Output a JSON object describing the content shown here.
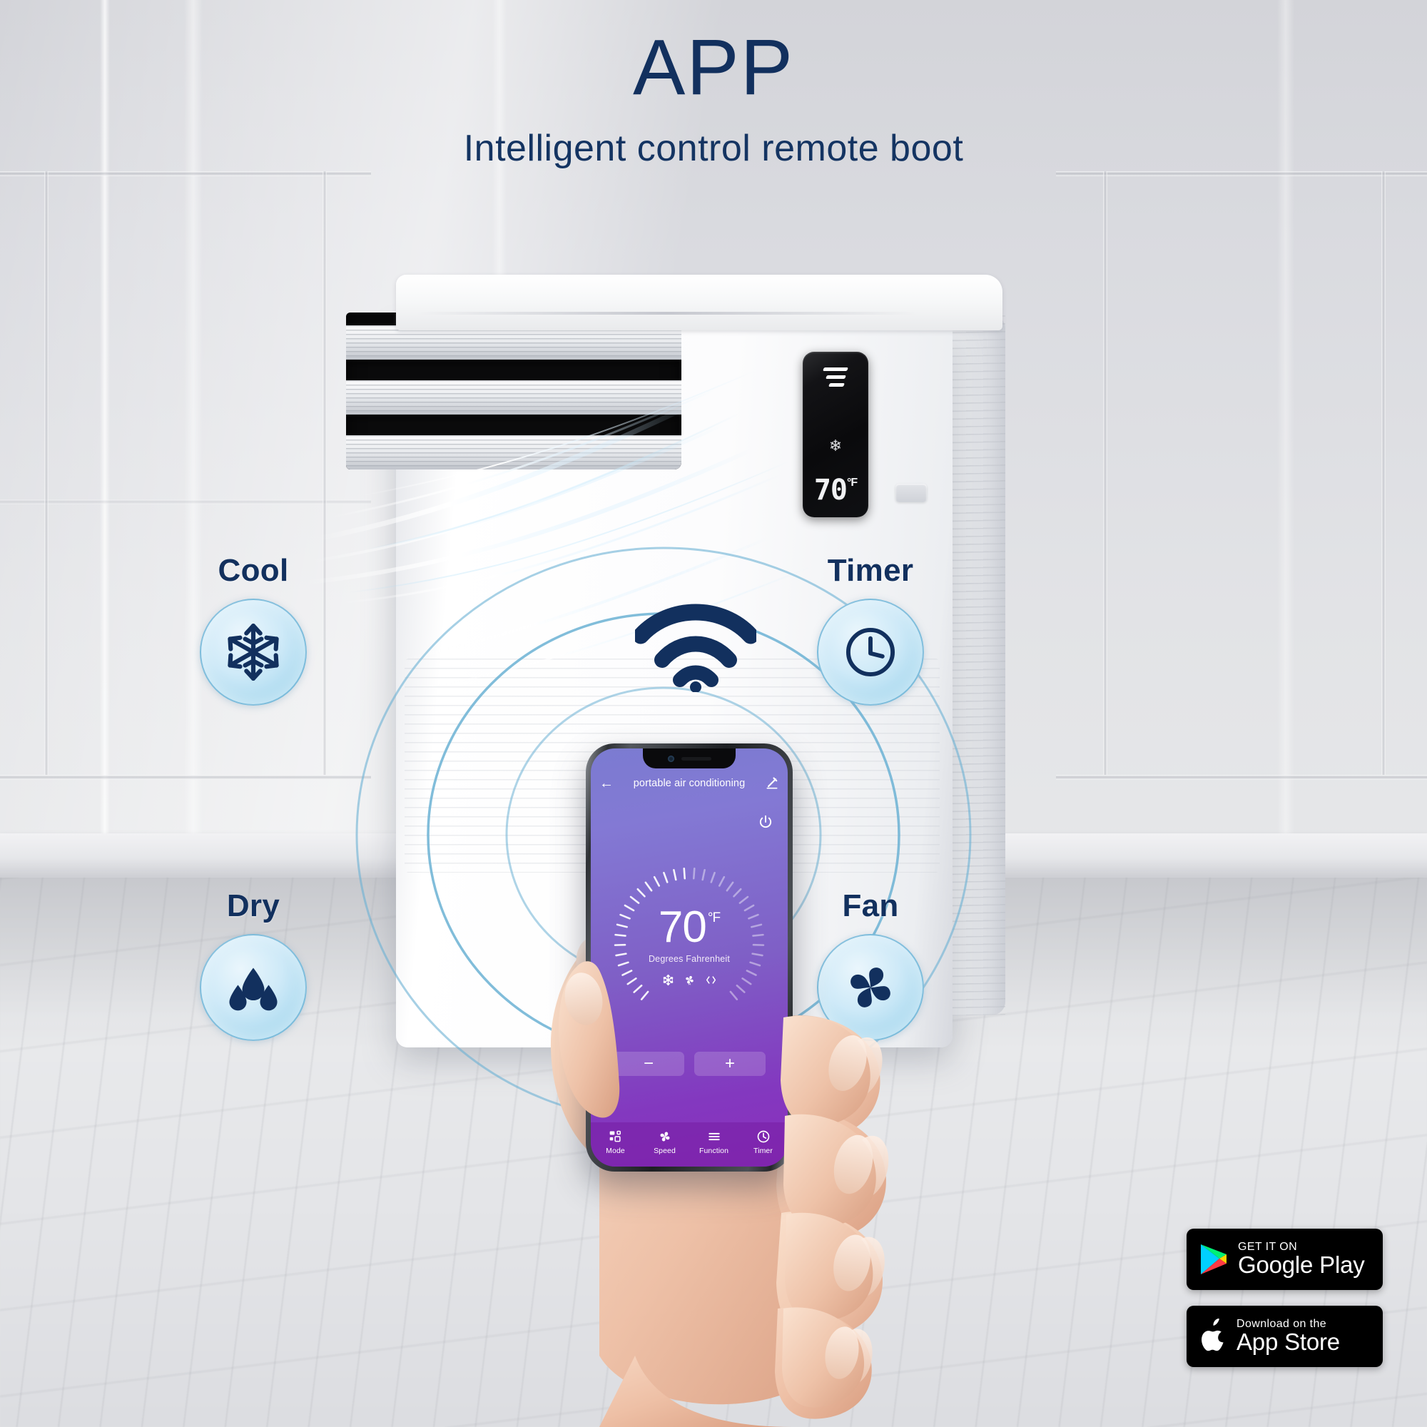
{
  "header": {
    "title": "APP",
    "subtitle": "Intelligent  control  remote boot",
    "title_color": "#12305e"
  },
  "theme": {
    "navy": "#12305e",
    "icon_circle_blue": "#a9d9ef",
    "ring_blue": "#6bb1d4",
    "phone_purple_top": "#7b7bd1",
    "phone_purple_bottom": "#8b2fbd"
  },
  "features": [
    {
      "label": "Cool",
      "icon": "snowflake-icon"
    },
    {
      "label": "Timer",
      "icon": "clock-icon"
    },
    {
      "label": "Dry",
      "icon": "water-droplets-icon"
    },
    {
      "label": "Fan",
      "icon": "fan-blades-icon"
    }
  ],
  "ac_unit": {
    "display": {
      "menu_icon": "signal-bars-icon",
      "mode_icon": "snowflake-icon",
      "temperature": "70",
      "unit": "°F"
    }
  },
  "wifi": {
    "icon": "wifi-icon"
  },
  "phone": {
    "app": {
      "back_icon": "back-arrow-icon",
      "title": "portable air conditioning",
      "edit_icon": "pencil-edit-icon",
      "power_icon": "power-icon",
      "dial": {
        "temperature": "70",
        "degree_unit": "°F",
        "caption": "Degrees Fahrenheit",
        "mode_icons": [
          "snowflake-icon",
          "fan-auto-icon",
          "swing-icon"
        ]
      },
      "stepper": {
        "decrease_label": "−",
        "increase_label": "+"
      },
      "tabs": [
        {
          "label": "Mode",
          "icon": "mode-grid-icon"
        },
        {
          "label": "Speed",
          "icon": "fan-blades-icon"
        },
        {
          "label": "Function",
          "icon": "list-lines-icon"
        },
        {
          "label": "Timer",
          "icon": "clock-icon"
        }
      ]
    }
  },
  "store_badges": [
    {
      "id": "google-play",
      "small": "GET IT ON",
      "big": "Google Play",
      "icon": "google-play-icon"
    },
    {
      "id": "app-store",
      "small": "Download on the",
      "big": "App Store",
      "icon": "apple-logo-icon"
    }
  ]
}
